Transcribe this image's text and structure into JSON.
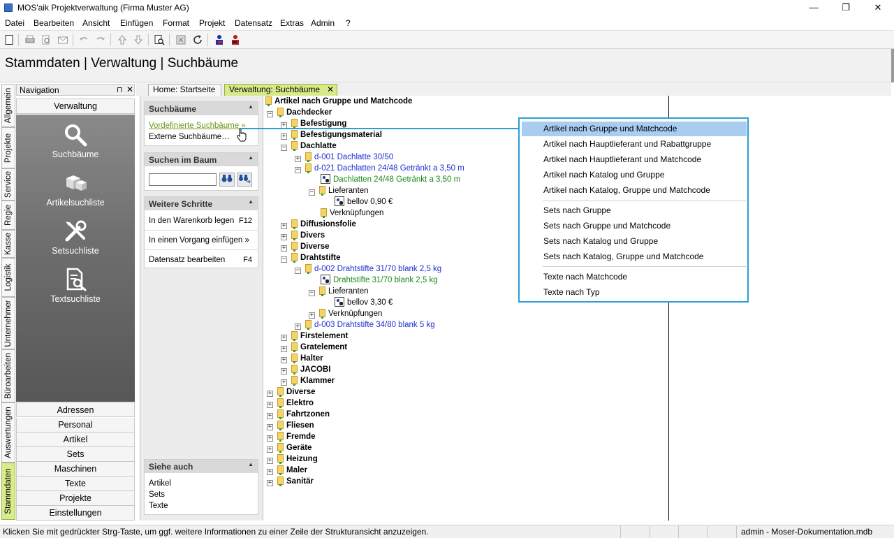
{
  "window": {
    "title": "MOS'aik Projektverwaltung (Firma Muster AG)",
    "minimize_glyph": "—",
    "maximize_glyph": "❐",
    "close_glyph": "✕"
  },
  "menu": [
    "Datei",
    "Bearbeiten",
    "Ansicht",
    "Einfügen",
    "Format",
    "Projekt",
    "Datensatz",
    "Extras",
    "Admin",
    "?"
  ],
  "toolbar_icons": [
    "new-document-icon",
    "print-icon",
    "print-preview-icon",
    "mail-icon",
    "undo-icon",
    "redo-icon",
    "move-up-icon",
    "move-down-icon",
    "search-document-icon",
    "calculator-icon",
    "refresh-icon",
    "user-blue-icon",
    "user-red-icon"
  ],
  "header": {
    "title": "Stammdaten | Verwaltung | Suchbäume"
  },
  "vertical_tabs": [
    "Allgemein",
    "Projekte",
    "Service",
    "Regie",
    "Kasse",
    "Logistik",
    "Unternehmer",
    "Büroarbeiten",
    "Auswertungen",
    "Stammdaten"
  ],
  "navigation": {
    "title": "Navigation",
    "pin_glyph": "⊓",
    "close_glyph": "✕",
    "section": "Verwaltung",
    "big_items": [
      {
        "label": "Suchbäume",
        "icon": "magnifier-icon"
      },
      {
        "label": "Artikelsuchliste",
        "icon": "boxes-icon"
      },
      {
        "label": "Setsuchliste",
        "icon": "tools-icon"
      },
      {
        "label": "Textsuchliste",
        "icon": "document-search-icon"
      }
    ],
    "items": [
      "Adressen",
      "Personal",
      "Artikel",
      "Sets",
      "Maschinen",
      "Texte",
      "Projekte",
      "Einstellungen"
    ]
  },
  "tabs": [
    {
      "label": "Home: Startseite"
    },
    {
      "label": "Verwaltung: Suchbäume",
      "close": "✕"
    }
  ],
  "panels": {
    "suchbaeume": {
      "title": "Suchbäume",
      "collapse": "▲",
      "links": [
        "Vordefinierte Suchbäume »",
        "Externe Suchbäume…"
      ]
    },
    "suchen": {
      "title": "Suchen im Baum",
      "collapse": "▲",
      "input_value": "",
      "find_glyph": "⚲",
      "find_next_glyph": "⚲"
    },
    "weitere": {
      "title": "Weitere Schritte",
      "collapse": "▲",
      "rows": [
        {
          "label": "In den Warenkorb legen",
          "key": "F12"
        },
        {
          "label": "In einen Vorgang einfügen »",
          "key": ""
        },
        {
          "label": "Datensatz bearbeiten",
          "key": "F4"
        }
      ]
    },
    "siehe": {
      "title": "Siehe auch",
      "collapse": "▲",
      "links": [
        "Artikel",
        "Sets",
        "Texte"
      ]
    }
  },
  "tree": {
    "root": "Artikel nach Gruppe und Matchcode",
    "rows": [
      {
        "text": "Dachdecker",
        "level": 0,
        "exp": "−",
        "icon": "folder",
        "style": "b"
      },
      {
        "text": "Befestigung",
        "level": 1,
        "exp": "+",
        "icon": "folder",
        "style": "b"
      },
      {
        "text": "Befestigungsmaterial",
        "level": 1,
        "exp": "+",
        "icon": "folder",
        "style": "b"
      },
      {
        "text": "Dachlatte",
        "level": 1,
        "exp": "−",
        "icon": "folder",
        "style": "b"
      },
      {
        "text": "d-001 Dachlatte 30/50",
        "level": 2,
        "exp": "+",
        "icon": "folder",
        "style": "blue"
      },
      {
        "text": "d-021 Dachlatten 24/48 Getränkt a 3,50 m",
        "level": 2,
        "exp": "−",
        "icon": "folder",
        "style": "blue"
      },
      {
        "text": "Dachlatten 24/48 Getränkt a 3,50 m",
        "level": 3,
        "exp": "",
        "icon": "art",
        "style": "green"
      },
      {
        "text": "Lieferanten",
        "level": 3,
        "exp": "−",
        "icon": "folder",
        "style": ""
      },
      {
        "text": "bellov 0,90 €",
        "level": 4,
        "exp": "",
        "icon": "art",
        "style": ""
      },
      {
        "text": "Verknüpfungen",
        "level": 3,
        "exp": "",
        "icon": "folder",
        "style": ""
      },
      {
        "text": "Diffusionsfolie",
        "level": 1,
        "exp": "+",
        "icon": "folder",
        "style": "b"
      },
      {
        "text": "Divers",
        "level": 1,
        "exp": "+",
        "icon": "folder",
        "style": "b"
      },
      {
        "text": "Diverse",
        "level": 1,
        "exp": "+",
        "icon": "folder",
        "style": "b"
      },
      {
        "text": "Drahtstifte",
        "level": 1,
        "exp": "−",
        "icon": "folder",
        "style": "b"
      },
      {
        "text": "d-002 Drahtstifte 31/70 blank 2,5 kg",
        "level": 2,
        "exp": "−",
        "icon": "folder",
        "style": "blue"
      },
      {
        "text": "Drahtstifte 31/70 blank 2,5 kg",
        "level": 3,
        "exp": "",
        "icon": "art",
        "style": "green"
      },
      {
        "text": "Lieferanten",
        "level": 3,
        "exp": "−",
        "icon": "folder",
        "style": ""
      },
      {
        "text": "bellov 3,30 €",
        "level": 4,
        "exp": "",
        "icon": "art",
        "style": ""
      },
      {
        "text": "Verknüpfungen",
        "level": 3,
        "exp": "+",
        "icon": "folder",
        "style": ""
      },
      {
        "text": "d-003 Drahtstifte 34/80 blank 5 kg",
        "level": 2,
        "exp": "+",
        "icon": "folder",
        "style": "blue"
      },
      {
        "text": "Firstelement",
        "level": 1,
        "exp": "+",
        "icon": "folder",
        "style": "b"
      },
      {
        "text": "Gratelement",
        "level": 1,
        "exp": "+",
        "icon": "folder",
        "style": "b"
      },
      {
        "text": "Halter",
        "level": 1,
        "exp": "+",
        "icon": "folder",
        "style": "b"
      },
      {
        "text": "JACOBI",
        "level": 1,
        "exp": "+",
        "icon": "folder",
        "style": "b"
      },
      {
        "text": "Klammer",
        "level": 1,
        "exp": "+",
        "icon": "folder",
        "style": "b"
      },
      {
        "text": "Diverse",
        "level": 0,
        "exp": "+",
        "icon": "folder",
        "style": "b"
      },
      {
        "text": "Elektro",
        "level": 0,
        "exp": "+",
        "icon": "folder",
        "style": "b"
      },
      {
        "text": "Fahrtzonen",
        "level": 0,
        "exp": "+",
        "icon": "folder",
        "style": "b"
      },
      {
        "text": "Fliesen",
        "level": 0,
        "exp": "+",
        "icon": "folder",
        "style": "b"
      },
      {
        "text": "Fremde",
        "level": 0,
        "exp": "+",
        "icon": "folder",
        "style": "b"
      },
      {
        "text": "Geräte",
        "level": 0,
        "exp": "+",
        "icon": "folder",
        "style": "b"
      },
      {
        "text": "Heizung",
        "level": 0,
        "exp": "+",
        "icon": "folder",
        "style": "b"
      },
      {
        "text": "Maler",
        "level": 0,
        "exp": "+",
        "icon": "folder",
        "style": "b"
      },
      {
        "text": "Sanitär",
        "level": 0,
        "exp": "+",
        "icon": "folder",
        "style": "b"
      }
    ]
  },
  "popup": {
    "selected": "Artikel nach Gruppe und Matchcode",
    "groups": [
      [
        "Artikel nach Gruppe und Matchcode",
        "Artikel nach Hauptlieferant und Rabattgruppe",
        "Artikel nach Hauptlieferant und Matchcode",
        "Artikel nach Katalog und Gruppe",
        "Artikel nach Katalog, Gruppe und Matchcode"
      ],
      [
        "Sets nach Gruppe",
        "Sets nach Gruppe und Matchcode",
        "Sets nach Katalog und Gruppe",
        "Sets nach Katalog, Gruppe und Matchcode"
      ],
      [
        "Texte nach Matchcode",
        "Texte nach Typ"
      ]
    ]
  },
  "status": {
    "text": "Klicken Sie mit gedrückter Strg-Taste, um ggf. weitere Informationen zu einer Zeile der Strukturansicht anzuzeigen.",
    "right": "admin - Moser-Dokumentation.mdb"
  }
}
